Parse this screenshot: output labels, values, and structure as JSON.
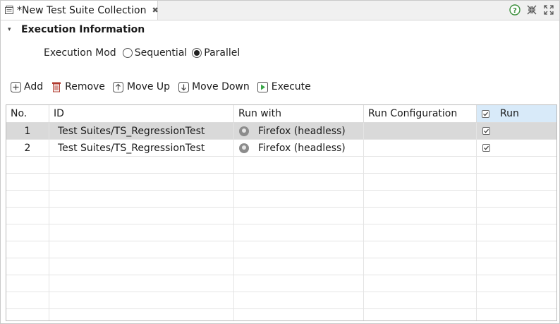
{
  "tab": {
    "title": "*New Test Suite Collection",
    "close_glyph": "✖"
  },
  "window_buttons": [
    {
      "name": "help-icon",
      "glyph": "?"
    },
    {
      "name": "minimize-icon",
      "glyph": ""
    },
    {
      "name": "maximize-icon",
      "glyph": ""
    }
  ],
  "section": {
    "title": "Execution Information",
    "twisty": "▾"
  },
  "execution_mode": {
    "label": "Execution Mod",
    "options": [
      {
        "label": "Sequential",
        "selected": false
      },
      {
        "label": "Parallel",
        "selected": true
      }
    ]
  },
  "toolbar": {
    "add_label": "Add",
    "remove_label": "Remove",
    "move_up_label": "Move Up",
    "move_down_label": "Move Down",
    "execute_label": "Execute"
  },
  "table": {
    "headers": {
      "no": "No.",
      "id": "ID",
      "run_with": "Run with",
      "run_configuration": "Run Configuration",
      "run": "Run"
    },
    "rows": [
      {
        "no": "1",
        "id": "Test Suites/TS_RegressionTest",
        "run_with": "Firefox (headless)",
        "run_configuration": "",
        "run": true,
        "selected": true
      },
      {
        "no": "2",
        "id": "Test Suites/TS_RegressionTest",
        "run_with": "Firefox (headless)",
        "run_configuration": "",
        "run": true,
        "selected": false
      }
    ]
  },
  "colors": {
    "accent_header": "#d8eaf9",
    "selected_row": "#d9d9d9",
    "execute_green": "#3aa84a",
    "remove_red": "#b03a2e"
  }
}
